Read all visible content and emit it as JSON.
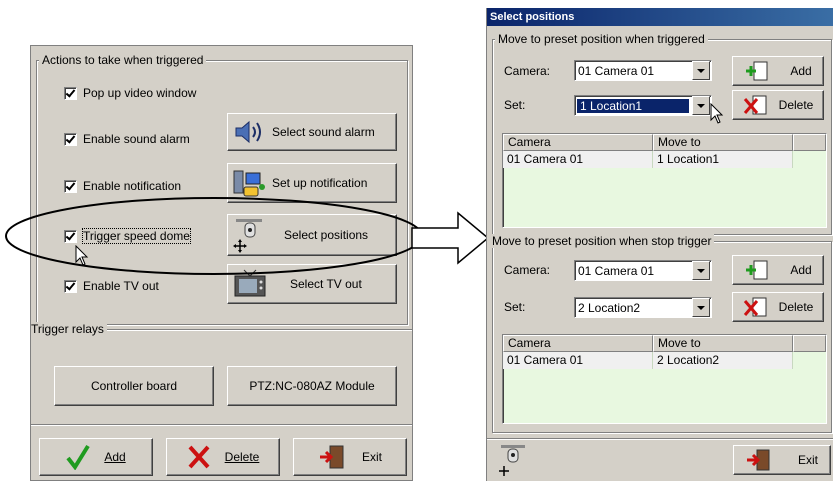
{
  "left": {
    "actions_legend": "Actions to take when triggered",
    "popup_label": "Pop up video window",
    "sound_label": "Enable sound alarm",
    "sound_button": "Select sound alarm",
    "notify_label": "Enable notification",
    "notify_button": "Set up notification",
    "speeddome_label": "Trigger speed dome",
    "positions_button": "Select positions",
    "tvout_label": "Enable TV out",
    "tvout_button": "Select TV out",
    "relays_legend": "Trigger relays",
    "controller_button": "Controller board",
    "ptz_button": "PTZ:NC-080AZ Module",
    "add_button": "Add",
    "delete_button": "Delete",
    "exit_button": "Exit"
  },
  "dialog": {
    "title": "Select positions",
    "triggered": {
      "legend": "Move to preset position when triggered",
      "camera_label": "Camera:",
      "camera_value": "01 Camera 01",
      "set_label": "Set:",
      "set_value": "1 Location1",
      "add_button": "Add",
      "delete_button": "Delete",
      "columns": [
        "Camera",
        "Move to"
      ],
      "rows": [
        [
          "01 Camera 01",
          "1 Location1"
        ]
      ]
    },
    "stop": {
      "legend": "Move to preset position when stop trigger",
      "camera_label": "Camera:",
      "camera_value": "01 Camera 01",
      "set_label": "Set:",
      "set_value": "2 Location2",
      "add_button": "Add",
      "delete_button": "Delete",
      "columns": [
        "Camera",
        "Move to"
      ],
      "rows": [
        [
          "01 Camera 01",
          "2 Location2"
        ]
      ]
    },
    "exit_button": "Exit"
  },
  "colors": {
    "face": "#d4d0c8",
    "title": "#0a246a",
    "grid": "#e8f8e0",
    "selection": "#0a246a"
  }
}
